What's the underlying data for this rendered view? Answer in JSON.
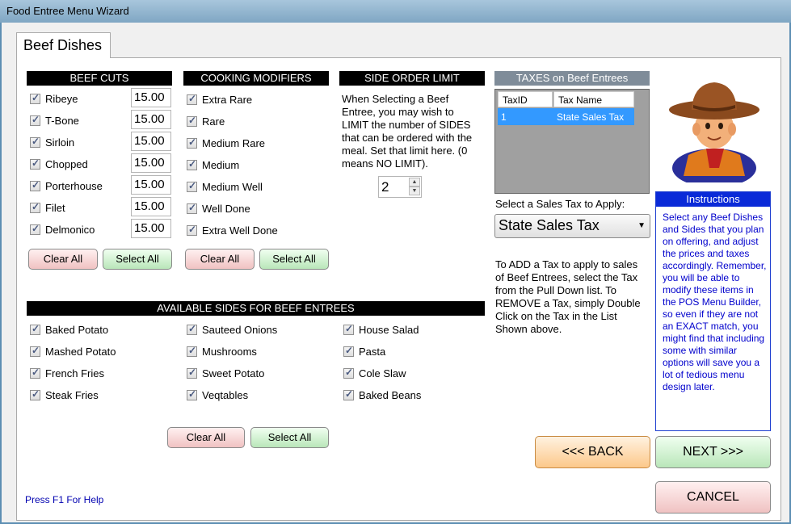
{
  "window": {
    "title": "Food Entree Menu Wizard"
  },
  "tab": {
    "label": "Beef Dishes"
  },
  "beef_cuts": {
    "header": "BEEF CUTS",
    "items": [
      {
        "label": "Ribeye",
        "price": "15.00"
      },
      {
        "label": "T-Bone",
        "price": "15.00"
      },
      {
        "label": "Sirloin",
        "price": "15.00"
      },
      {
        "label": "Chopped",
        "price": "15.00"
      },
      {
        "label": "Porterhouse",
        "price": "15.00"
      },
      {
        "label": "Filet",
        "price": "15.00"
      },
      {
        "label": "Delmonico",
        "price": "15.00"
      }
    ],
    "clear_label": "Clear All",
    "select_label": "Select All"
  },
  "cooking_modifiers": {
    "header": "COOKING MODIFIERS",
    "items": [
      "Extra Rare",
      "Rare",
      "Medium Rare",
      "Medium",
      "Medium Well",
      "Well Done",
      "Extra Well Done"
    ],
    "clear_label": "Clear All",
    "select_label": "Select All"
  },
  "side_order_limit": {
    "header": "SIDE ORDER LIMIT",
    "text": "When Selecting a Beef Entree, you may wish to LIMIT the number of SIDES that can be ordered with the meal.  Set that limit here.  (0 means NO LIMIT).",
    "value": "2"
  },
  "taxes": {
    "header": "TAXES on Beef Entrees",
    "columns": [
      "TaxID",
      "Tax Name"
    ],
    "rows": [
      {
        "id": "1",
        "name": "State Sales Tax"
      }
    ],
    "select_label": "Select a Sales Tax to Apply:",
    "selected": "State Sales Tax",
    "help_text": "To ADD a Tax to apply to sales of Beef Entrees, select the Tax from the Pull Down list.  To REMOVE a Tax, simply Double Click on the Tax in the List Shown above."
  },
  "instructions": {
    "header": "Instructions",
    "text": "Select any Beef Dishes and Sides that you plan on offering, and adjust the prices and taxes accordingly.  Remember, you will be able to modify these items in the POS Menu Builder, so even if they are not an EXACT match, you might find that including some with similar options will save you a lot of tedious menu design later."
  },
  "sides": {
    "header": "AVAILABLE SIDES FOR BEEF ENTREES",
    "col1": [
      "Baked Potato",
      "Mashed Potato",
      "French Fries",
      "Steak Fries"
    ],
    "col2": [
      "Sauteed Onions",
      "Mushrooms",
      "Sweet Potato",
      "Veqtables"
    ],
    "col3": [
      "House Salad",
      "Pasta",
      "Cole Slaw",
      "Baked Beans"
    ],
    "clear_label": "Clear All",
    "select_label": "Select All"
  },
  "nav": {
    "back_label": "<<< BACK",
    "next_label": "NEXT >>>",
    "cancel_label": "CANCEL"
  },
  "help": {
    "label": "Press F1 For Help"
  },
  "colors": {
    "instructions_blue": "#0a2ad8",
    "selected_row": "#3399ff",
    "hat_brown": "#8a4a1e"
  }
}
